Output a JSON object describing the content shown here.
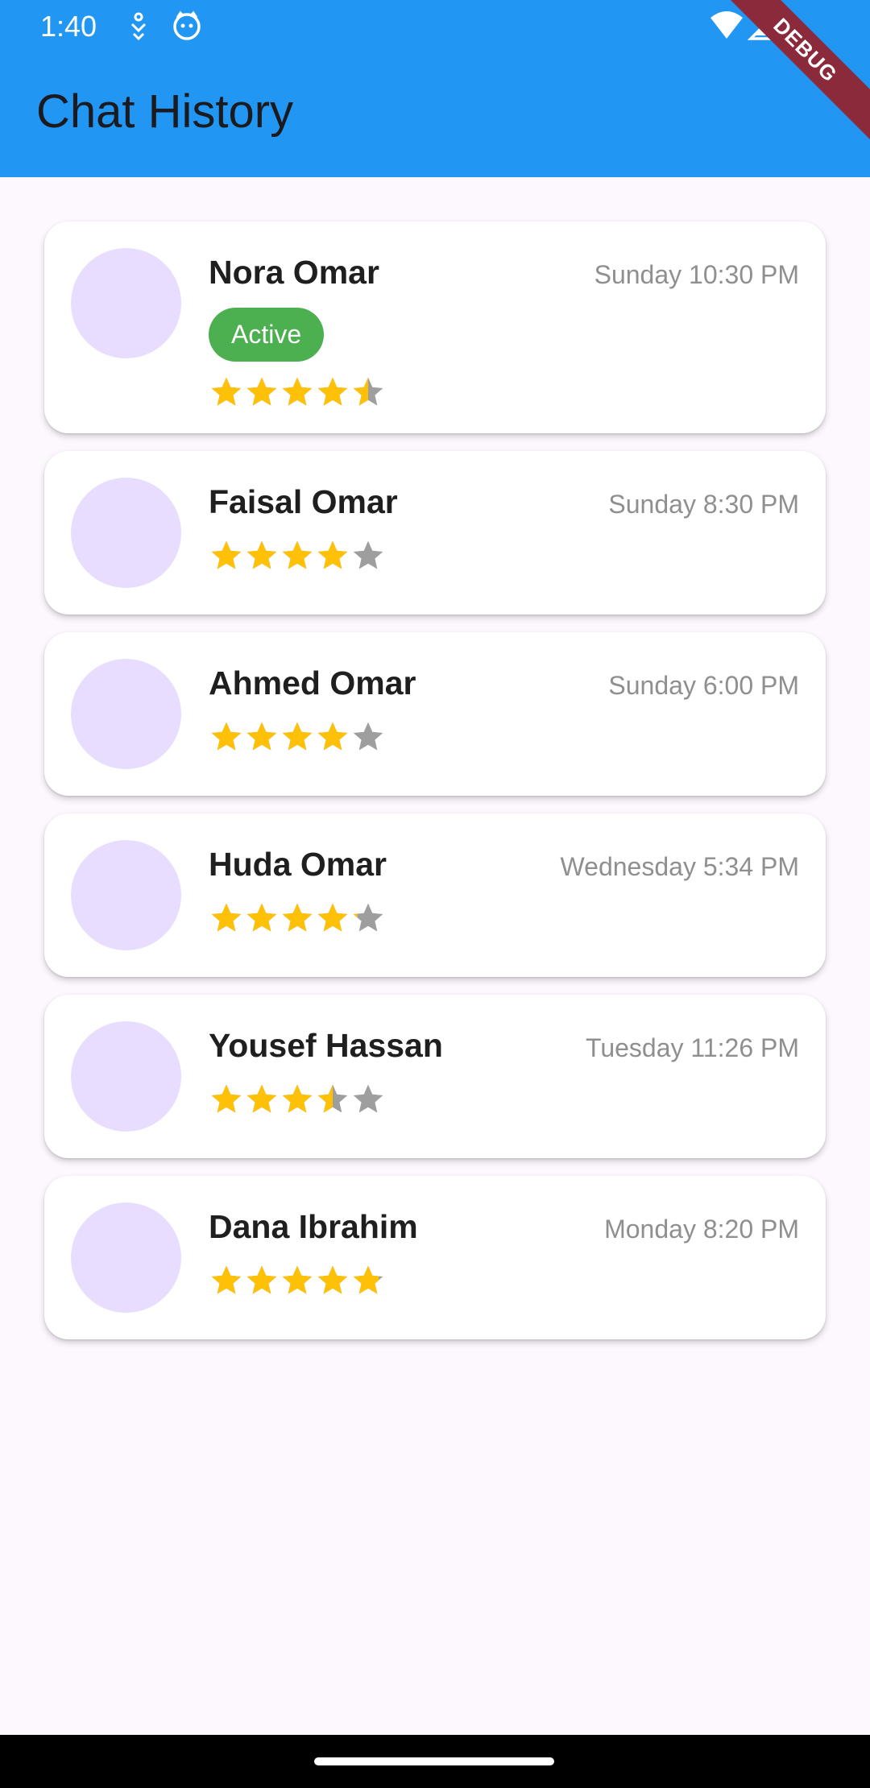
{
  "status_bar": {
    "time": "1:40",
    "icons": [
      "download-person-icon",
      "cat-face-icon",
      "wifi-icon",
      "signal-icon"
    ]
  },
  "app_bar": {
    "title": "Chat History",
    "debug_label": "DEBUG"
  },
  "colors": {
    "app_bar": "#2196F3",
    "background": "#FDF7FE",
    "avatar": "#E9DDFF",
    "active_badge": "#4CAF50",
    "star_filled": "#FFC107",
    "star_empty": "#9E9E9E"
  },
  "chats": [
    {
      "name": "Nora Omar",
      "time": "Sunday 10:30 PM",
      "badge": "Active",
      "rating": 4.5
    },
    {
      "name": "Faisal Omar",
      "time": "Sunday 8:30 PM",
      "badge": "",
      "rating": 4
    },
    {
      "name": "Ahmed Omar",
      "time": "Sunday 6:00 PM",
      "badge": "",
      "rating": 4
    },
    {
      "name": "Huda Omar",
      "time": "Wednesday 5:34 PM",
      "badge": "",
      "rating": 4.2
    },
    {
      "name": "Yousef Hassan",
      "time": "Tuesday 11:26 PM",
      "badge": "",
      "rating": 3.5
    },
    {
      "name": "Dana Ibrahim",
      "time": "Monday 8:20 PM",
      "badge": "",
      "rating": 4.8
    }
  ]
}
